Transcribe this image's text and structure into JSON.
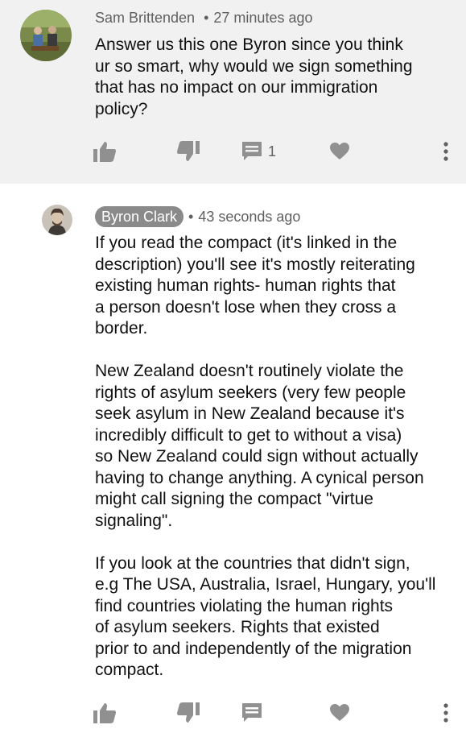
{
  "comments": [
    {
      "author": "Sam Brittenden",
      "separator": "•",
      "time": "27 minutes ago",
      "paragraphs": [
        "Answer us this one Byron since you think\nur so smart, why would we sign something\nthat has no impact on our immigration\npolicy?"
      ],
      "reply_count": "1",
      "icons": [
        "thumbs-up-icon",
        "thumbs-down-icon",
        "reply-icon",
        "heart-icon",
        "more-vertical-icon"
      ]
    },
    {
      "author": "Byron Clark",
      "separator": "•",
      "time": "43 seconds ago",
      "paragraphs": [
        "If you read the compact  (it's linked in the\ndescription) you'll see it's mostly reiterating\nexisting human rights- human rights that\na person doesn't lose when they cross a\nborder.",
        "New Zealand doesn't routinely violate the\nrights of asylum seekers (very few people\nseek asylum in New Zealand because it's\nincredibly difficult to get to without a visa)\nso New Zealand could sign without actually\nhaving to change anything. A cynical person\nmight call signing the compact \"virtue\nsignaling\".",
        "If you look at the countries that didn't sign,\ne.g The USA, Australia, Israel, Hungary, you'll\nfind countries violating the human rights\nof asylum seekers. Rights that existed\nprior to and independently of the migration\ncompact."
      ],
      "icons": [
        "thumbs-up-icon",
        "thumbs-down-icon",
        "reply-icon",
        "heart-icon",
        "more-vertical-icon"
      ]
    }
  ],
  "colors": {
    "highlight_bg": "#f1f1f1",
    "text": "#111111",
    "meta_text": "#606060",
    "author_chip_bg": "#8a8a8a",
    "icon": "#909090"
  }
}
